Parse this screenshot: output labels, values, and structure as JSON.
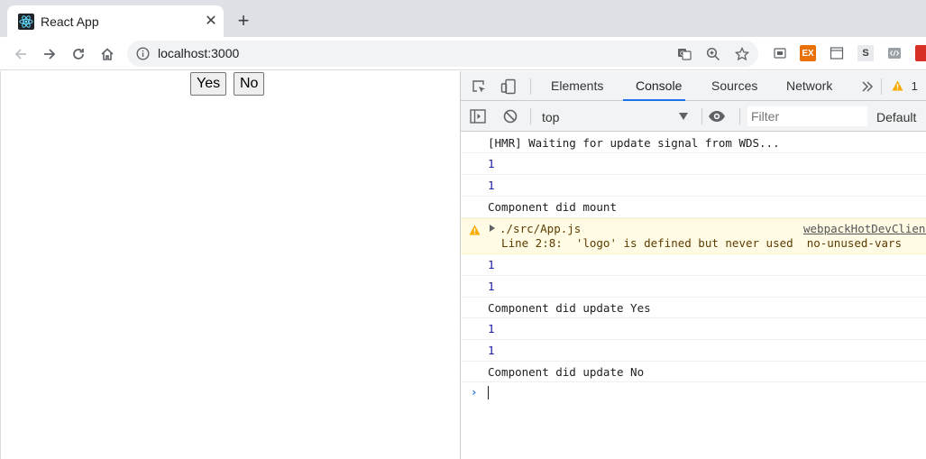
{
  "browser": {
    "tab_title": "React App",
    "url": "localhost:3000"
  },
  "app": {
    "yes_label": "Yes",
    "no_label": "No"
  },
  "devtools": {
    "tabs": [
      "Elements",
      "Console",
      "Sources",
      "Network"
    ],
    "active_tab": "Console",
    "warning_count": "1",
    "context": "top",
    "filter_placeholder": "Filter",
    "levels": "Default",
    "messages": [
      {
        "type": "log",
        "text": "[HMR] Waiting for update signal from WDS..."
      },
      {
        "type": "num",
        "text": "1"
      },
      {
        "type": "num",
        "text": "1"
      },
      {
        "type": "log",
        "text": "Component did mount"
      },
      {
        "type": "warn",
        "text": "./src/App.js",
        "detail": "  Line 2:8:  'logo' is defined but never used  no-unused-vars",
        "source": "webpackHotDevClient.js"
      },
      {
        "type": "num",
        "text": "1"
      },
      {
        "type": "num",
        "text": "1"
      },
      {
        "type": "log",
        "text": "Component did update Yes"
      },
      {
        "type": "num",
        "text": "1"
      },
      {
        "type": "num",
        "text": "1"
      },
      {
        "type": "log",
        "text": "Component did update No"
      }
    ]
  },
  "colors": {
    "accent": "#1a73e8",
    "warning": "#f9ab00",
    "number": "#1a1aa6"
  }
}
